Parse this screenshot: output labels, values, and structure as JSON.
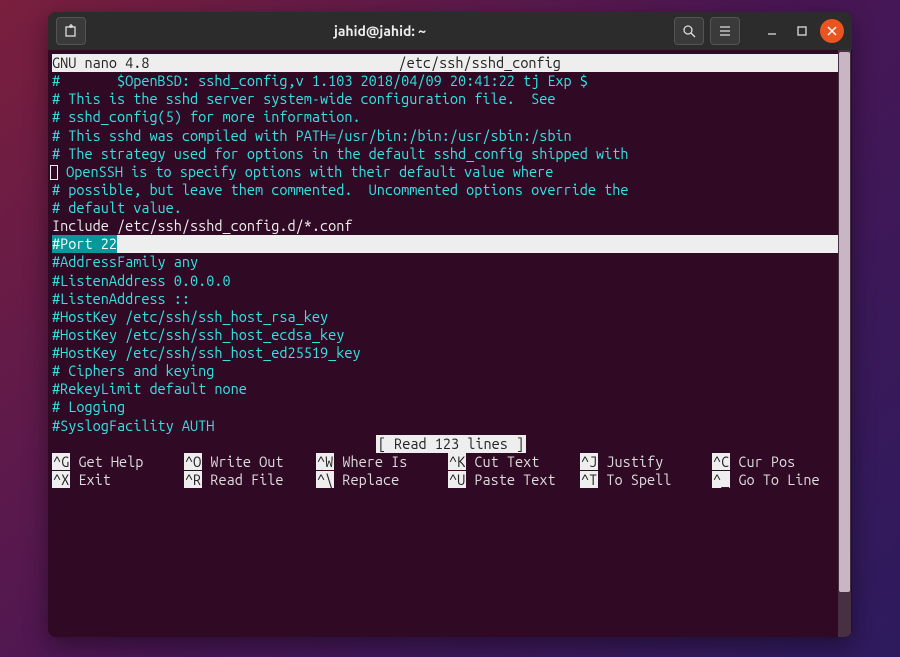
{
  "titlebar": {
    "title": "jahid@jahid: ~",
    "newtab_icon": "new-tab-icon",
    "search_icon": "search-icon",
    "menu_icon": "hamburger-icon"
  },
  "nano": {
    "version": "GNU nano 4.8",
    "filepath": "/etc/ssh/sshd_config",
    "status": "[ Read 123 lines ]",
    "highlighted": "#Port 22",
    "lines": {
      "l1": "#       $OpenBSD: sshd_config,v 1.103 2018/04/09 20:41:22 tj Exp $",
      "l2": "",
      "l3": "# This is the sshd server system-wide configuration file.  See",
      "l4": "# sshd_config(5) for more information.",
      "l5": "",
      "l6": "# This sshd was compiled with PATH=/usr/bin:/bin:/usr/sbin:/sbin",
      "l7": "",
      "l8a": "# The strategy used for options in the default sshd_config shipped with",
      "l8b": " OpenSSH is to specify options with their default value where",
      "l9": "# possible, but leave them commented.  Uncommented options override the",
      "l10": "# default value.",
      "l11": "",
      "l12": "Include /etc/ssh/sshd_config.d/*.conf",
      "l13": "",
      "l15": "#AddressFamily any",
      "l16": "#ListenAddress 0.0.0.0",
      "l17": "#ListenAddress ::",
      "l18": "",
      "l19": "#HostKey /etc/ssh/ssh_host_rsa_key",
      "l20": "#HostKey /etc/ssh/ssh_host_ecdsa_key",
      "l21": "#HostKey /etc/ssh/ssh_host_ed25519_key",
      "l22": "",
      "l23": "# Ciphers and keying",
      "l24": "#RekeyLimit default none",
      "l25": "",
      "l26": "# Logging",
      "l27": "#SyslogFacility AUTH"
    },
    "shortcuts": [
      {
        "key": "^G",
        "label": "Get Help"
      },
      {
        "key": "^O",
        "label": "Write Out"
      },
      {
        "key": "^W",
        "label": "Where Is"
      },
      {
        "key": "^K",
        "label": "Cut Text"
      },
      {
        "key": "^J",
        "label": "Justify"
      },
      {
        "key": "^C",
        "label": "Cur Pos"
      },
      {
        "key": "^X",
        "label": "Exit"
      },
      {
        "key": "^R",
        "label": "Read File"
      },
      {
        "key": "^\\",
        "label": "Replace"
      },
      {
        "key": "^U",
        "label": "Paste Text"
      },
      {
        "key": "^T",
        "label": "To Spell"
      },
      {
        "key": "^_",
        "label": "Go To Line"
      }
    ]
  }
}
